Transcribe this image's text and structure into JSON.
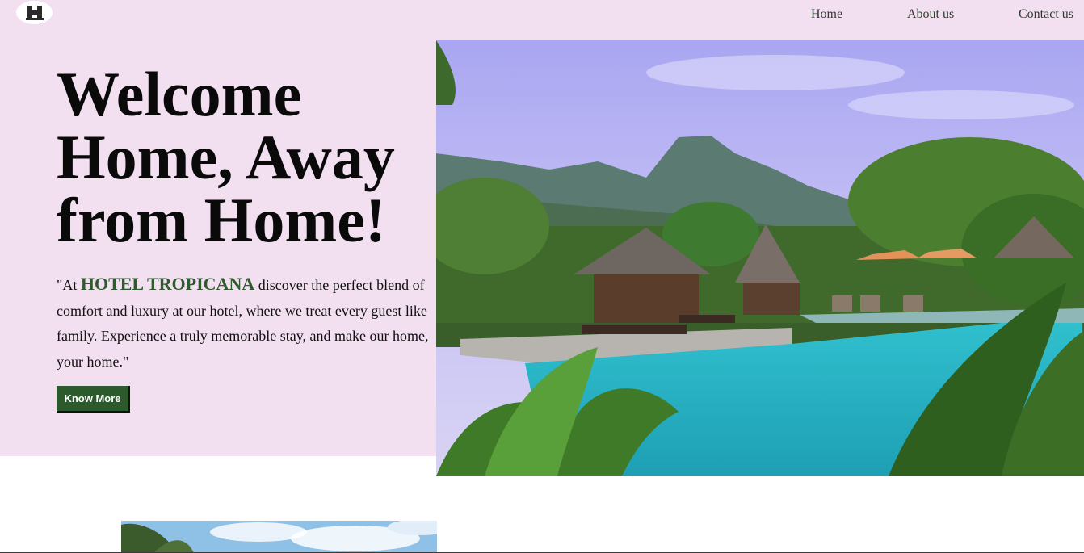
{
  "logo": {
    "letter": "H"
  },
  "nav": {
    "items": [
      {
        "label": "Home"
      },
      {
        "label": "About us"
      },
      {
        "label": "Contact us"
      }
    ]
  },
  "hero": {
    "headline": "Welcome Home, Away from Home!",
    "desc_prefix": "\"At ",
    "brand": "HOTEL TROPICANA",
    "desc_rest": " discover the perfect blend of comfort and luxury at our hotel, where we treat every guest like family. Experience a truly memorable stay, and make our home, your home.\"",
    "cta_label": "Know More"
  },
  "colors": {
    "hero_background": "#f2dff0",
    "button": "#2d5a2d",
    "brand_text": "#2e5a2e",
    "nav_text": "#2b3b2b"
  }
}
